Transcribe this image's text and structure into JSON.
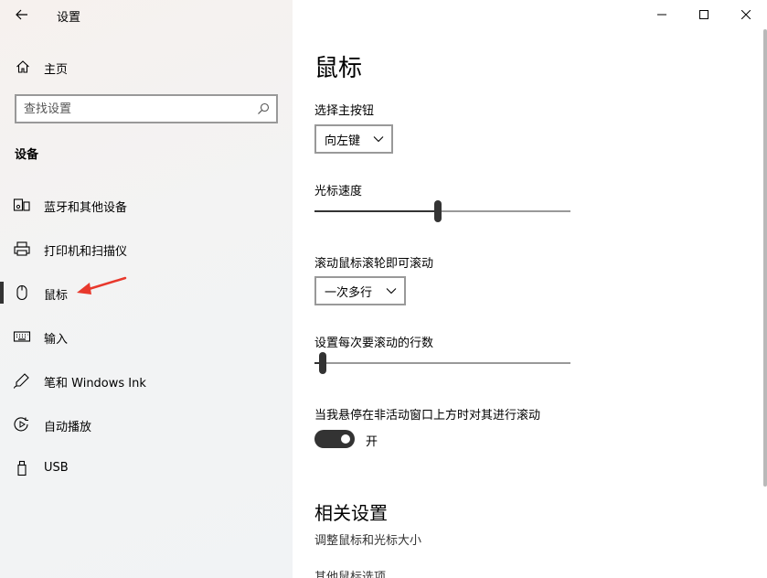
{
  "window": {
    "title": "设置"
  },
  "sidebar": {
    "home_label": "主页",
    "search_placeholder": "查找设置",
    "section_title": "设备",
    "items": [
      {
        "label": "蓝牙和其他设备",
        "icon": "bluetooth-devices-icon"
      },
      {
        "label": "打印机和扫描仪",
        "icon": "printer-icon"
      },
      {
        "label": "鼠标",
        "icon": "mouse-icon",
        "active": true
      },
      {
        "label": "输入",
        "icon": "keyboard-icon"
      },
      {
        "label": "笔和 Windows Ink",
        "icon": "pen-icon"
      },
      {
        "label": "自动播放",
        "icon": "autoplay-icon"
      },
      {
        "label": "USB",
        "icon": "usb-icon"
      }
    ]
  },
  "main": {
    "title": "鼠标",
    "primary_button_label": "选择主按钮",
    "primary_button_value": "向左键",
    "cursor_speed_label": "光标速度",
    "cursor_speed_fraction": 0.48,
    "scroll_wheel_label": "滚动鼠标滚轮即可滚动",
    "scroll_wheel_value": "一次多行",
    "lines_to_scroll_label": "设置每次要滚动的行数",
    "lines_to_scroll_fraction": 0.02,
    "inactive_scroll_label": "当我悬停在非活动窗口上方时对其进行滚动",
    "inactive_scroll_state": "开",
    "related_title": "相关设置",
    "related_links": [
      "调整鼠标和光标大小",
      "其他鼠标选项"
    ]
  },
  "colors": {
    "accent": "#333333",
    "arrow": "#e8382c"
  }
}
